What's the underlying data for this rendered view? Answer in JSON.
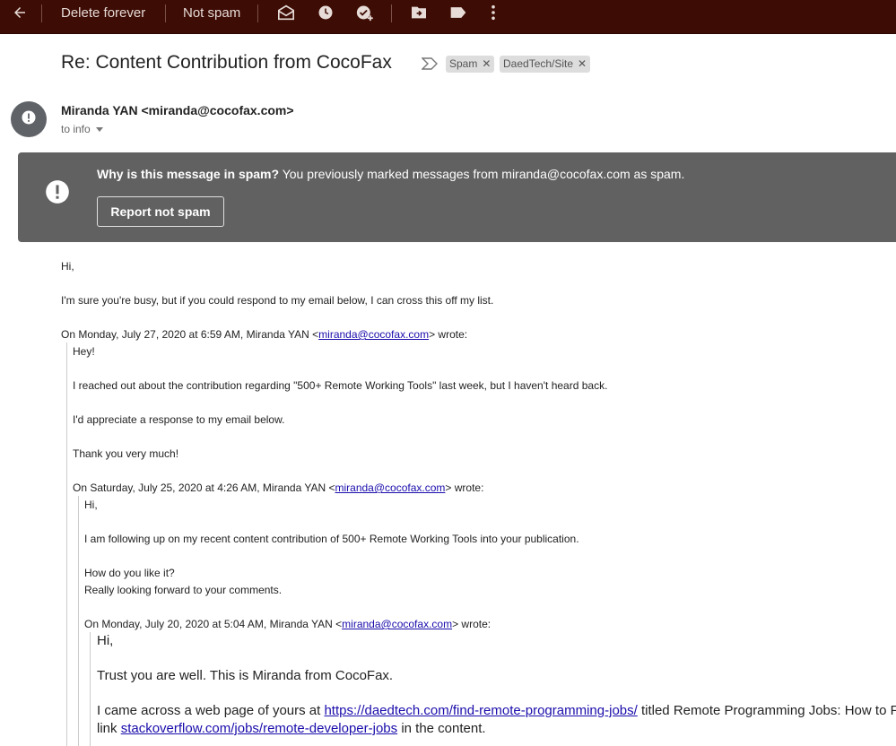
{
  "toolbar": {
    "back_icon": "arrow-left-icon",
    "delete_forever": "Delete forever",
    "not_spam": "Not spam",
    "icons": [
      "mark-unread-icon",
      "snooze-icon",
      "add-to-tasks-icon",
      "move-to-icon",
      "label-icon",
      "more-vert-icon"
    ]
  },
  "email": {
    "subject": "Re: Content Contribution from CocoFax",
    "labels": [
      {
        "text": "Spam"
      },
      {
        "text": "DaedTech/Site"
      }
    ],
    "sender": "Miranda YAN <miranda@cocofax.com>",
    "to_line": "to info"
  },
  "spam_warning": {
    "bold": "Why is this message in spam?",
    "text": " You previously marked messages from miranda@cocofax.com as spam.",
    "button": "Report not spam"
  },
  "body": {
    "greeting": "Hi,",
    "line1": "I'm sure you're busy, but if you could respond to my email below, I can cross this off my list.",
    "quote1": {
      "attrib_pre": "On Monday, July 27, 2020 at 6:59 AM, Miranda YAN <",
      "email": "miranda@cocofax.com",
      "attrib_post": "> wrote:",
      "lines": [
        "Hey!",
        "I reached out about the contribution regarding \"500+ Remote Working Tools\" last week, but I haven't heard back.",
        "I'd appreciate a response to my email below.",
        "Thank you very much!"
      ]
    },
    "quote2": {
      "attrib_pre": "On Saturday, July 25, 2020 at 4:26 AM, Miranda YAN <",
      "email": "miranda@cocofax.com",
      "attrib_post": "> wrote:",
      "lines": [
        "Hi,",
        "I am following up on my recent content contribution of 500+ Remote Working Tools into your publication.",
        "How do you like it?",
        "Really looking forward to your comments."
      ]
    },
    "quote3": {
      "attrib_pre": "On Monday, July 20, 2020 at 5:04 AM, Miranda YAN <",
      "email": "miranda@cocofax.com",
      "attrib_post": "> wrote:",
      "hi": "Hi,",
      "line1": "Trust you are well. This is Miranda from CocoFax.",
      "line2_pre": "I came across a web page of yours at ",
      "line2_link": "https://daedtech.com/find-remote-programming-jobs/",
      "line2_post": " titled Remote Programming Jobs: How to Find",
      "line3_pre": "link ",
      "line3_link": "stackoverflow.com/jobs/remote-developer-jobs",
      "line3_post": " in the content."
    }
  }
}
